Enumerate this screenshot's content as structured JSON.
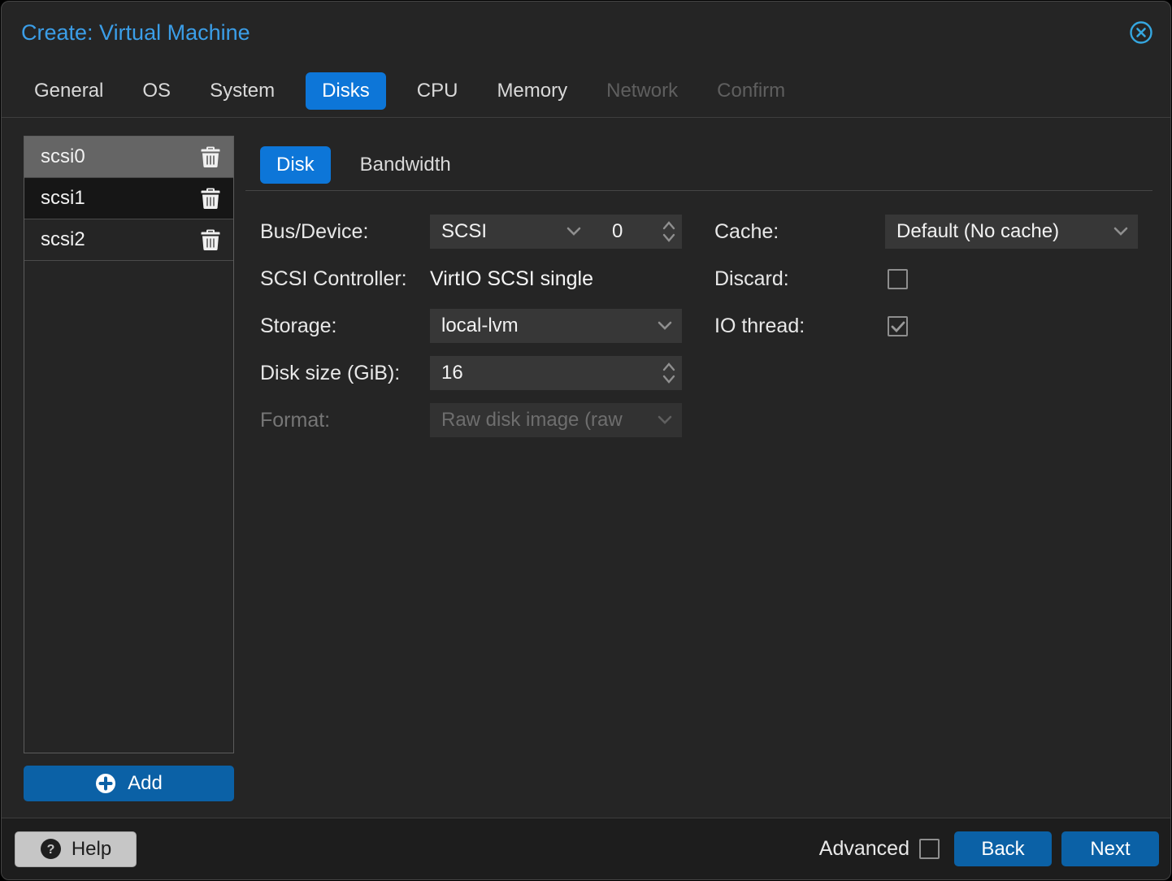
{
  "window": {
    "title": "Create: Virtual Machine"
  },
  "wizard_tabs": [
    {
      "label": "General",
      "state": "enabled"
    },
    {
      "label": "OS",
      "state": "enabled"
    },
    {
      "label": "System",
      "state": "enabled"
    },
    {
      "label": "Disks",
      "state": "active"
    },
    {
      "label": "CPU",
      "state": "enabled"
    },
    {
      "label": "Memory",
      "state": "enabled"
    },
    {
      "label": "Network",
      "state": "disabled"
    },
    {
      "label": "Confirm",
      "state": "disabled"
    }
  ],
  "disk_list": {
    "items": [
      {
        "name": "scsi0",
        "selected": true
      },
      {
        "name": "scsi1",
        "selected": false
      },
      {
        "name": "scsi2",
        "selected": false
      }
    ],
    "add_label": "Add"
  },
  "disk_panel": {
    "tabs": [
      {
        "label": "Disk",
        "active": true
      },
      {
        "label": "Bandwidth",
        "active": false
      }
    ],
    "fields": {
      "bus_device": {
        "label": "Bus/Device:",
        "bus": "SCSI",
        "device": "0"
      },
      "scsi_controller": {
        "label": "SCSI Controller:",
        "value": "VirtIO SCSI single"
      },
      "storage": {
        "label": "Storage:",
        "value": "local-lvm"
      },
      "disk_size": {
        "label": "Disk size (GiB):",
        "value": "16"
      },
      "format": {
        "label": "Format:",
        "value": "Raw disk image (raw",
        "disabled": true
      },
      "cache": {
        "label": "Cache:",
        "value": "Default (No cache)"
      },
      "discard": {
        "label": "Discard:",
        "checked": false
      },
      "io_thread": {
        "label": "IO thread:",
        "checked": true
      }
    }
  },
  "footer": {
    "help_label": "Help",
    "advanced_label": "Advanced",
    "advanced_checked": false,
    "back_label": "Back",
    "next_label": "Next"
  },
  "icons": {
    "close": "circle-x",
    "delete": "trash-can",
    "add": "plus-circle",
    "help": "question-circle",
    "dropdown": "chevron-down",
    "number_stepper": "chevron-up-down",
    "checked": "checkmark"
  },
  "colors": {
    "dialog_bg": "#252525",
    "footer_bg": "#1d1d1d",
    "title_blue": "#3b9ee8",
    "active_tab_blue": "#0d76d8",
    "button_blue": "#0b61a6",
    "field_bg": "#373737",
    "help_bg": "#c6c6c6",
    "selected_row": "#656565",
    "close_icon_blue": "#35a7e0"
  }
}
